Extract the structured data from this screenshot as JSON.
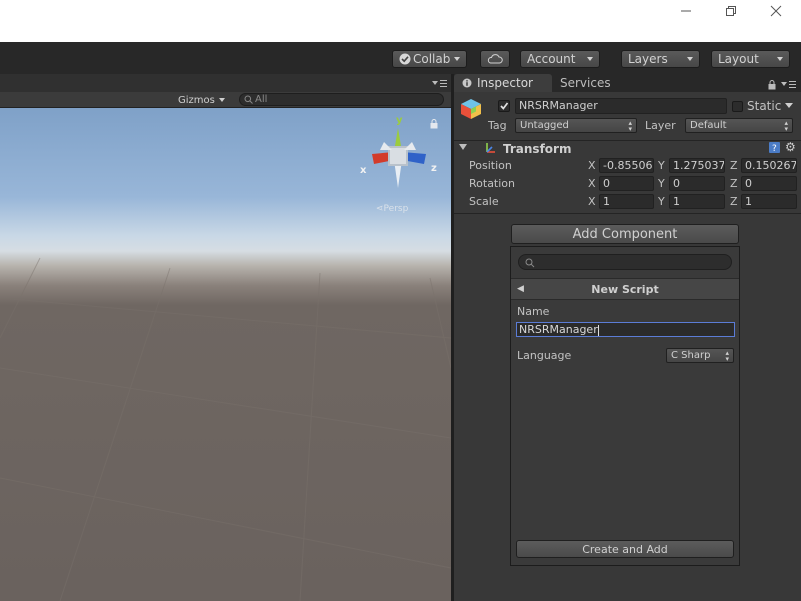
{
  "toolbar": {
    "collab_label": "Collab",
    "account_label": "Account",
    "layers_label": "Layers",
    "layout_label": "Layout"
  },
  "scene": {
    "gizmos_label": "Gizmos",
    "search_placeholder": "All",
    "persp_label": "Persp",
    "axes": {
      "x": "x",
      "y": "y",
      "z": "z"
    }
  },
  "inspector": {
    "tabs": [
      {
        "label": "Inspector"
      },
      {
        "label": "Services"
      }
    ],
    "object_name": "NRSRManager",
    "static_label": "Static",
    "tag_label": "Tag",
    "tag_value": "Untagged",
    "layer_label": "Layer",
    "layer_value": "Default",
    "transform": {
      "title": "Transform",
      "position": {
        "label": "Position",
        "x": "-0.85506",
        "y": "1.275037",
        "z": "0.150267"
      },
      "rotation": {
        "label": "Rotation",
        "x": "0",
        "y": "0",
        "z": "0"
      },
      "scale": {
        "label": "Scale",
        "x": "1",
        "y": "1",
        "z": "1"
      }
    },
    "add_component_label": "Add Component",
    "new_script": {
      "title": "New Script",
      "name_label": "Name",
      "name_value": "NRSRManager",
      "language_label": "Language",
      "language_value": "C Sharp",
      "create_label": "Create and Add"
    }
  },
  "axis_letters": {
    "x": "X",
    "y": "Y",
    "z": "Z"
  }
}
